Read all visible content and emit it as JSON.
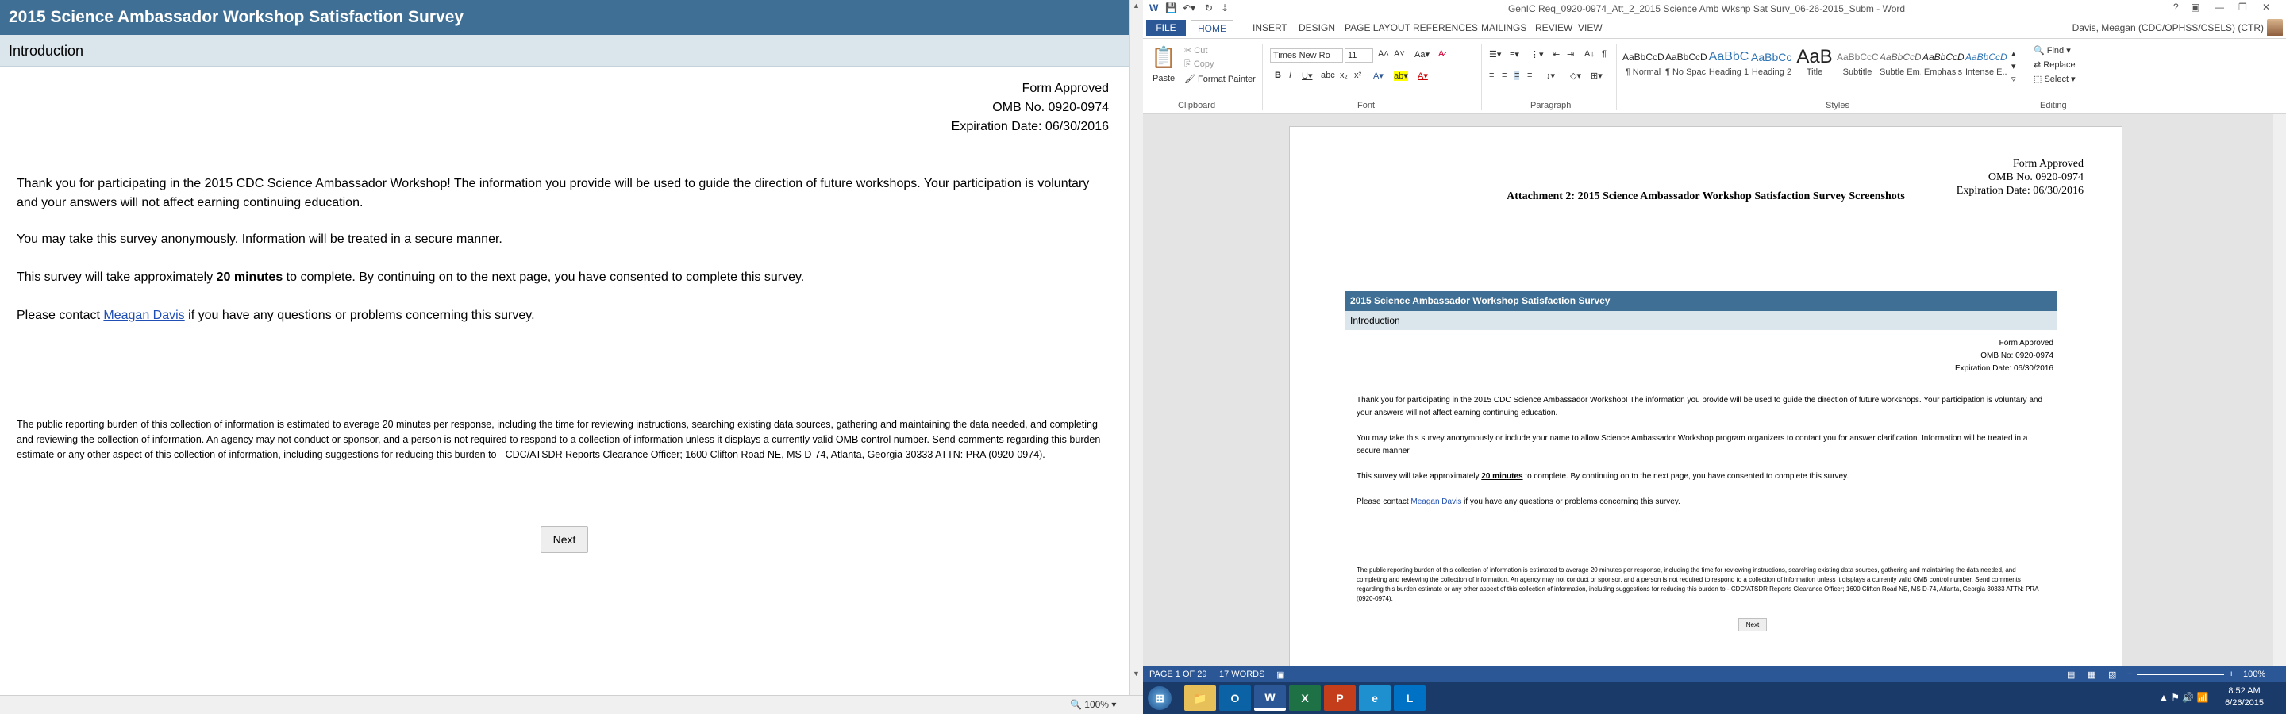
{
  "survey": {
    "title": "2015 Science Ambassador Workshop Satisfaction Survey",
    "section": "Introduction",
    "omb": [
      "Form Approved",
      "OMB No. 0920-0974",
      "Expiration Date: 06/30/2016"
    ],
    "p1": "Thank you for participating in the 2015 CDC Science Ambassador Workshop! The information you provide will be used to guide the direction of future workshops. Your participation is voluntary and your answers will not affect earning continuing education.",
    "p2": "You may take this survey anonymously. Information will be treated in a secure manner.",
    "p3_pre": "This survey will take approximately ",
    "p3_bold": "20 minutes",
    "p3_post": " to complete. By continuing on to the next page, you have consented to complete this survey.",
    "p4_pre": "Please contact ",
    "p4_link": "Meagan Davis",
    "p4_post": " if you have any questions or problems concerning this survey.",
    "burden": "The public reporting burden of this collection of information is estimated to average 20 minutes per response, including the time for reviewing instructions, searching existing data sources, gathering and maintaining the data needed, and completing and reviewing the collection of information. An agency may not conduct or sponsor, and a person is not required to respond to a collection of information unless it displays a currently valid OMB control number. Send comments regarding this burden estimate or any other aspect of this collection of information, including suggestions for reducing this burden to - CDC/ATSDR Reports Clearance Officer; 1600 Clifton Road NE, MS D-74, Atlanta, Georgia 30333 ATTN: PRA (0920-0974).",
    "next": "Next",
    "zoom": "100%"
  },
  "word": {
    "title": "GenIC Req_0920-0974_Att_2_2015 Science Amb Wkshp Sat Surv_06-26-2015_Subm - Word",
    "tabs": [
      "FILE",
      "HOME",
      "INSERT",
      "DESIGN",
      "PAGE LAYOUT",
      "REFERENCES",
      "MAILINGS",
      "REVIEW",
      "VIEW"
    ],
    "user": "Davis, Meagan (CDC/OPHSS/CSELS) (CTR)",
    "clipboard": {
      "paste": "Paste",
      "cut": "Cut",
      "copy": "Copy",
      "painter": "Format Painter",
      "label": "Clipboard"
    },
    "font": {
      "name": "Times New Ro",
      "size": "11",
      "label": "Font"
    },
    "paragraph_label": "Paragraph",
    "styles_label": "Styles",
    "editing_label": "Editing",
    "styles": [
      {
        "sample": "AaBbCcDc",
        "name": "¶ Normal"
      },
      {
        "sample": "AaBbCcDc",
        "name": "¶ No Spac..."
      },
      {
        "sample": "AaBbC",
        "name": "Heading 1"
      },
      {
        "sample": "AaBbCcI",
        "name": "Heading 2"
      },
      {
        "sample": "AaB",
        "name": "Title"
      },
      {
        "sample": "AaBbCcC",
        "name": "Subtitle"
      },
      {
        "sample": "AaBbCcDc",
        "name": "Subtle Em..."
      },
      {
        "sample": "AaBbCcDc",
        "name": "Emphasis"
      },
      {
        "sample": "AaBbCcDc",
        "name": "Intense E..."
      }
    ],
    "editing": {
      "find": "Find",
      "replace": "Replace",
      "select": "Select"
    },
    "doc": {
      "omb": [
        "Form Approved",
        "OMB No. 0920-0974",
        "Expiration Date:  06/30/2016"
      ],
      "attachment": "Attachment 2:  2015 Science Ambassador Workshop Satisfaction Survey Screenshots",
      "p2": "You may take this survey anonymously or include your name to allow Science Ambassador Workshop program organizers to contact you for answer clarification. Information will be treated in a secure manner.",
      "omb_small": [
        "Form Approved",
        "OMB No: 0920-0974",
        "Expiration Date: 06/30/2016"
      ]
    },
    "status": {
      "page": "PAGE 1 OF 29",
      "words": "17 WORDS",
      "zoom": "100%"
    },
    "clock": {
      "time": "8:52 AM",
      "date": "6/26/2015"
    }
  },
  "taskbar": [
    "start",
    "explorer",
    "outlook",
    "word",
    "excel",
    "powerpoint",
    "ie",
    "lync"
  ]
}
